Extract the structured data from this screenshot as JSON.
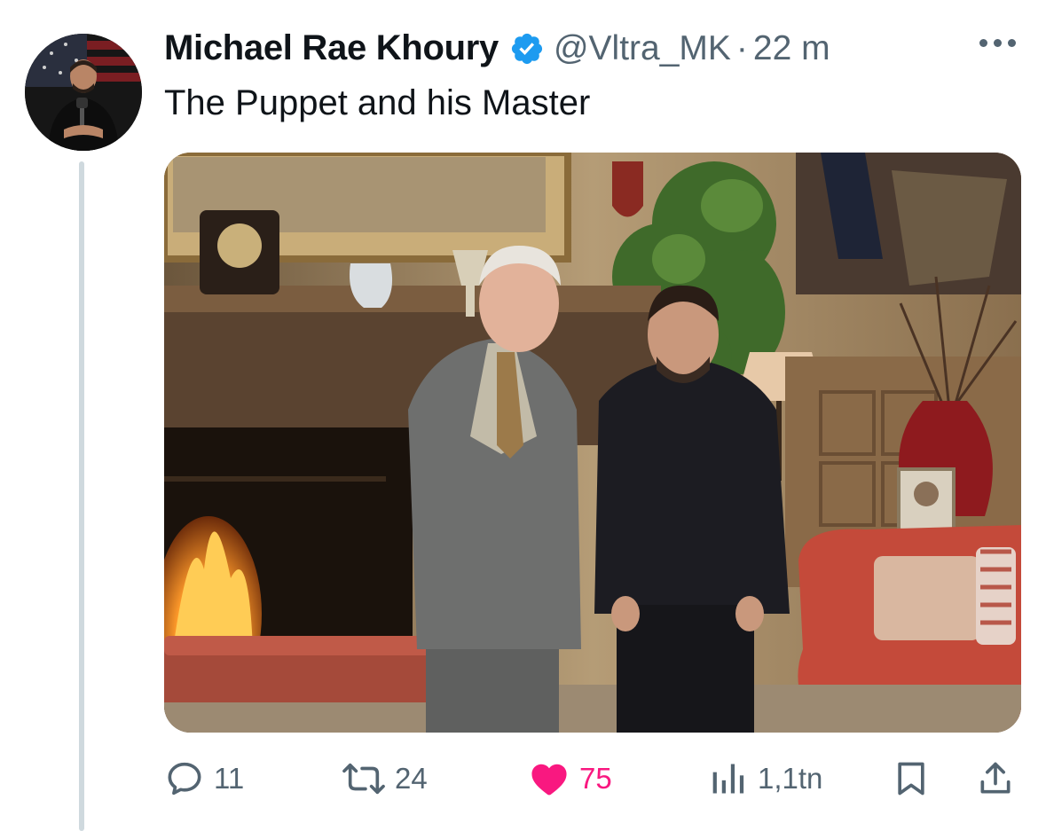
{
  "tweet": {
    "author_name": "Michael Rae Khoury",
    "handle": "@Vltra_MK",
    "separator": "·",
    "time": "22 m",
    "text": "The Puppet and his Master",
    "verified": true
  },
  "actions": {
    "reply": {
      "icon": "reply-icon",
      "count": "11"
    },
    "retweet": {
      "icon": "retweet-icon",
      "count": "24"
    },
    "like": {
      "icon": "heart-icon",
      "count": "75",
      "liked": true
    },
    "views": {
      "icon": "views-icon",
      "count": "1,1tn"
    },
    "bookmark": {
      "icon": "bookmark-icon"
    },
    "share": {
      "icon": "share-icon"
    }
  },
  "colors": {
    "verified": "#1d9bf0",
    "like": "#f91880",
    "secondary_text": "#536471",
    "thread_line": "#cfd9de"
  }
}
